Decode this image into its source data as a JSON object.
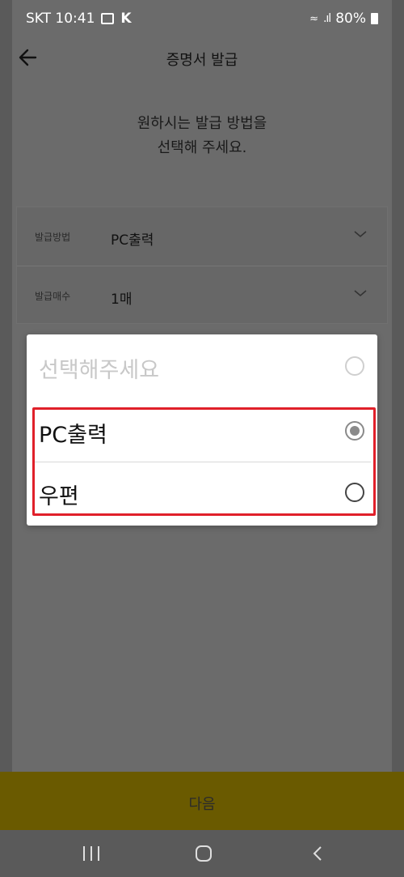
{
  "status_bar": {
    "carrier_time": "SKT 10:41",
    "k_label": "K",
    "battery": "80%"
  },
  "header": {
    "title": "증명서 발급"
  },
  "intro": {
    "line1": "원하시는 발급 방법을",
    "line2": "선택해 주세요."
  },
  "form": {
    "method_label": "발급방법",
    "method_value": "PC출력",
    "count_label": "발급매수",
    "count_value": "1매"
  },
  "dialog": {
    "options": [
      {
        "label": "선택해주세요",
        "state": "placeholder"
      },
      {
        "label": "PC출력",
        "state": "selected"
      },
      {
        "label": "우편",
        "state": "unselected"
      }
    ]
  },
  "footer": {
    "next_label": "다음"
  },
  "colors": {
    "highlight": "#e0202a",
    "next_button": "#6a5a00"
  }
}
